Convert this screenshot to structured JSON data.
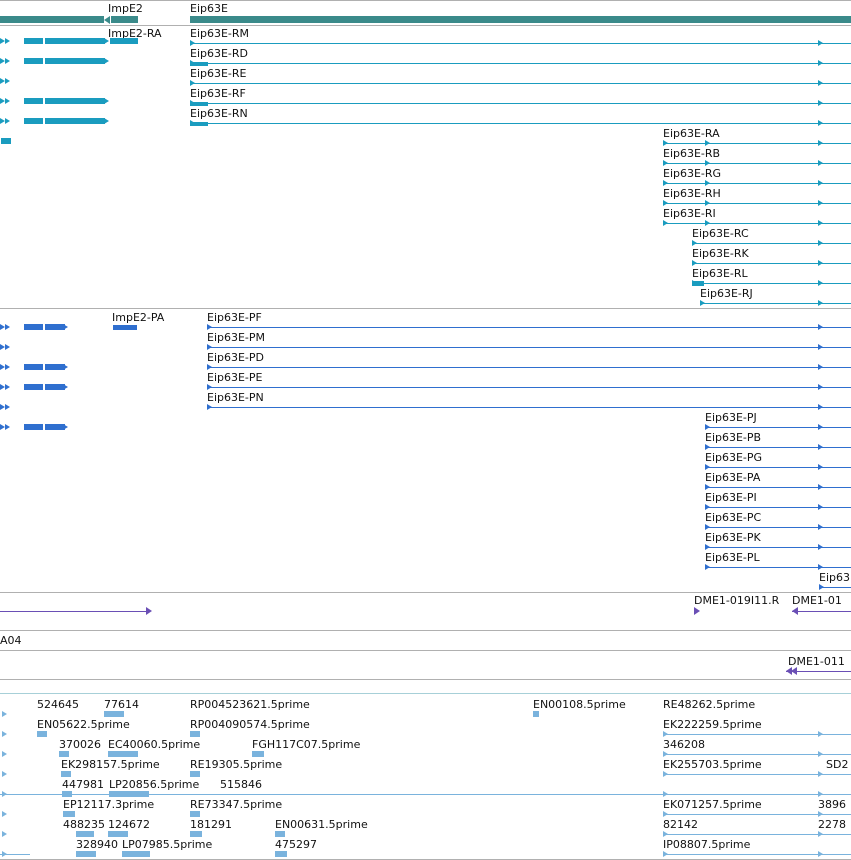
{
  "colors": {
    "gene": "#3a8a8a",
    "rna": "#1a9cbf",
    "protein": "#2f6fcf",
    "clone": "#6a4fb5",
    "est": "#7ab3dd",
    "separator": "#b0b0b0"
  },
  "tracks": {
    "gene": {
      "labels": [
        "ImpE2",
        "Eip63E"
      ]
    },
    "transcripts": {
      "labels": [
        "ImpE2-RA",
        "Eip63E-RM",
        "Eip63E-RD",
        "Eip63E-RE",
        "Eip63E-RF",
        "Eip63E-RN",
        "Eip63E-RA",
        "Eip63E-RB",
        "Eip63E-RG",
        "Eip63E-RH",
        "Eip63E-RI",
        "Eip63E-RC",
        "Eip63E-RK",
        "Eip63E-RL",
        "Eip63E-RJ"
      ]
    },
    "proteins": {
      "labels": [
        "ImpE2-PA",
        "Eip63E-PF",
        "Eip63E-PM",
        "Eip63E-PD",
        "Eip63E-PE",
        "Eip63E-PN",
        "Eip63E-PJ",
        "Eip63E-PB",
        "Eip63E-PG",
        "Eip63E-PA",
        "Eip63E-PI",
        "Eip63E-PC",
        "Eip63E-PK",
        "Eip63E-PL",
        "Eip63"
      ]
    },
    "clones": {
      "labels": [
        "DME1-019I11.R",
        "DME1-01"
      ]
    },
    "track_a04": {
      "label": "A04"
    },
    "track_dme": {
      "label": "DME1-011"
    },
    "ests": {
      "labels": [
        "524645",
        "77614",
        "RP004523621.5prime",
        "EN00108.5prime",
        "RE48262.5prime",
        "EN05622.5prime",
        "RP004090574.5prime",
        "EK222259.5prime",
        "370026",
        "EC40060.5prime",
        "FGH117C07.5prime",
        "346208",
        "EK298157.5prime",
        "RE19305.5prime",
        "EK255703.5prime",
        "SD2",
        "447981",
        "LP20856.5prime",
        "515846",
        "EP12117.3prime",
        "RE73347.5prime",
        "EK071257.5prime",
        "3896",
        "488235",
        "124672",
        "181291",
        "EN00631.5prime",
        "82142",
        "2278",
        "328940",
        "LP07985.5prime",
        "475297",
        "IP08807.5prime"
      ]
    }
  }
}
